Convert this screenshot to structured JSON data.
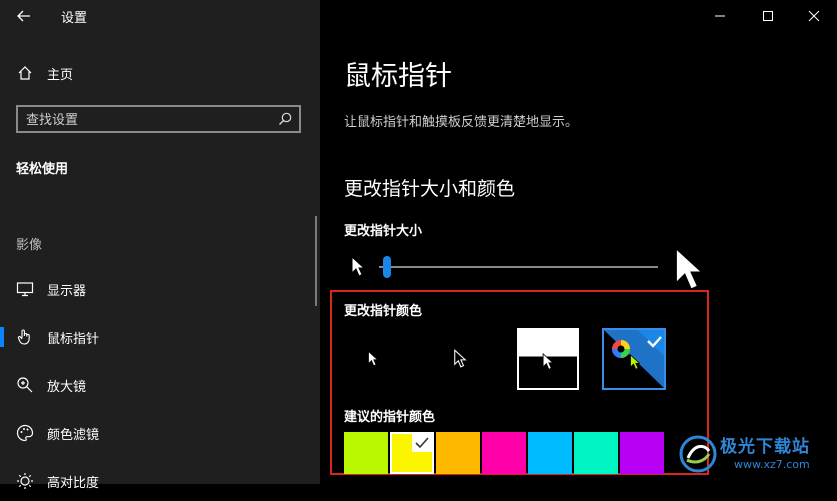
{
  "window": {
    "title": "设置"
  },
  "sidebar": {
    "home_label": "主页",
    "search_placeholder": "查找设置",
    "group_heading": "轻松使用",
    "section_heading": "影像",
    "items": [
      {
        "label": "显示器",
        "icon": "monitor-icon"
      },
      {
        "label": "鼠标指针",
        "icon": "hand-pointer-icon",
        "active": true
      },
      {
        "label": "放大镜",
        "icon": "magnifier-icon"
      },
      {
        "label": "颜色滤镜",
        "icon": "palette-icon"
      },
      {
        "label": "高对比度",
        "icon": "contrast-icon"
      }
    ]
  },
  "main": {
    "title": "鼠标指针",
    "description": "让鼠标指针和触摸板反馈更清楚地显示。",
    "section_title": "更改指针大小和颜色",
    "size": {
      "label": "更改指针大小",
      "value": 0.02
    },
    "color": {
      "label": "更改指针颜色",
      "options": [
        "white",
        "black",
        "inverted",
        "custom"
      ],
      "selected": "custom"
    },
    "suggested": {
      "label": "建议的指针颜色",
      "colors": [
        "#b9f700",
        "#fbf600",
        "#ffb800",
        "#ff00a8",
        "#00bbff",
        "#00f4c2",
        "#b800f5"
      ],
      "selected_index": 1
    }
  },
  "watermark": {
    "name": "极光下载站",
    "url": "www.xz7.com"
  },
  "colors": {
    "accent": "#1a86e8",
    "frame": "#d9261c",
    "sidebar_bg": "#1f1f1f",
    "main_bg": "#000000"
  }
}
